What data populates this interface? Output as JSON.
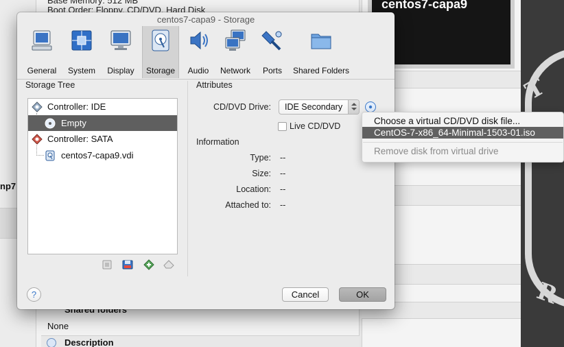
{
  "background": {
    "base_memory": "Base Memory:    512 MB",
    "boot_order": "Boot Order:       Floppy, CD/DVD, Hard Disk",
    "left_fragment": "np7",
    "preview_title": "centos7-capa9",
    "shared_folders_header": "Shared folders",
    "shared_folders_value": "None",
    "description_header": "Description"
  },
  "dialog": {
    "title": "centos7-capa9 - Storage",
    "toolbar": [
      {
        "label": "General",
        "icon": "general-icon"
      },
      {
        "label": "System",
        "icon": "system-icon"
      },
      {
        "label": "Display",
        "icon": "display-icon"
      },
      {
        "label": "Storage",
        "icon": "storage-icon",
        "selected": true
      },
      {
        "label": "Audio",
        "icon": "audio-icon"
      },
      {
        "label": "Network",
        "icon": "network-icon"
      },
      {
        "label": "Ports",
        "icon": "ports-icon"
      },
      {
        "label": "Shared Folders",
        "icon": "shared-folders-icon"
      }
    ],
    "storage_tree": {
      "title": "Storage Tree",
      "items": [
        {
          "label": "Controller: IDE",
          "icon": "ide-controller-icon"
        },
        {
          "label": "Empty",
          "icon": "cd-icon",
          "selected": true
        },
        {
          "label": "Controller: SATA",
          "icon": "sata-controller-icon"
        },
        {
          "label": "centos7-capa9.vdi",
          "icon": "hard-disk-icon"
        }
      ]
    },
    "attributes": {
      "title": "Attributes",
      "cd_dvd_drive_label": "CD/DVD Drive:",
      "cd_dvd_drive_value": "IDE Secondary",
      "live_cd_label": "Live CD/DVD"
    },
    "information": {
      "title": "Information",
      "rows": [
        {
          "label": "Type:",
          "value": "--"
        },
        {
          "label": "Size:",
          "value": "--"
        },
        {
          "label": "Location:",
          "value": "--"
        },
        {
          "label": "Attached to:",
          "value": "--"
        }
      ]
    },
    "buttons": {
      "help": "?",
      "cancel": "Cancel",
      "ok": "OK"
    }
  },
  "popup_menu": {
    "items": [
      {
        "label": "Choose a virtual CD/DVD disk file..."
      },
      {
        "label": "CentOS-7-x86_64-Minimal-1503-01.iso",
        "selected": true
      },
      {
        "label": "Remove disk from virtual drive",
        "disabled": true
      }
    ]
  },
  "colors": {
    "selection": "#5f5f5f",
    "accent_blue": "#3a78c9",
    "dialog_bg": "#ececec"
  }
}
